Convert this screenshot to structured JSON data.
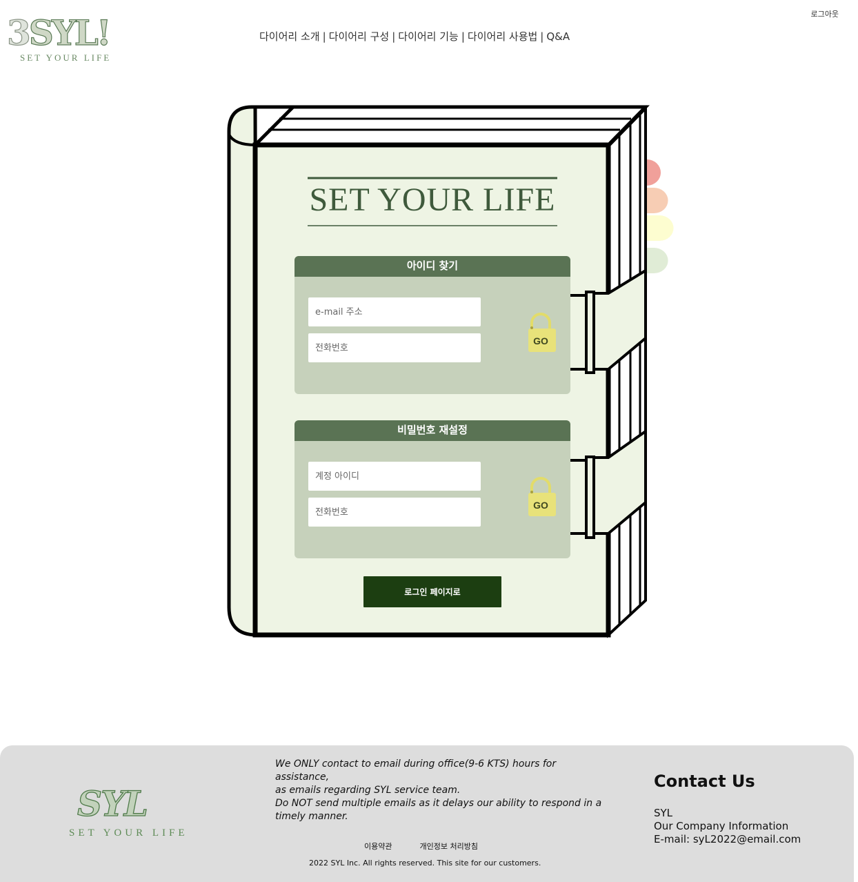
{
  "header": {
    "logo_main_digit": "3",
    "logo_main_text": "SYL!",
    "logo_sub": "SET YOUR LIFE",
    "nav": [
      "다이어리 소개",
      "다이어리 구성",
      "다이어리 기능",
      "다이어리 사용법",
      "Q&A"
    ],
    "nav_separator": "|",
    "logout": "로그아웃"
  },
  "book": {
    "title": "SET YOUR LIFE",
    "tab_colors": [
      "#f0a09a",
      "#f7cdb4",
      "#fdfdd0",
      "#e0ecd6"
    ],
    "cover_color": "#eef4e4",
    "find_id": {
      "heading": "아이디 찾기",
      "email_placeholder": "e-mail 주소",
      "phone_placeholder": "전화번호",
      "go_label": "GO"
    },
    "reset_password": {
      "heading": "비밀번호 재설정",
      "account_placeholder": "계정 아이디",
      "phone_placeholder": "전화번호",
      "go_label": "GO"
    },
    "to_login_label": "로그인 페이지로"
  },
  "footer": {
    "logo_main": "SYL",
    "logo_sub": "SET YOUR LIFE",
    "notice_lines": [
      "We ONLY contact to email during office(9-6 KTS) hours for assistance,",
      "as emails regarding SYL service team.",
      "Do NOT send multiple emails as it delays our ability to respond in a",
      "timely manner."
    ],
    "links": [
      "이용약관",
      "개인정보 처리방침"
    ],
    "copyright": "2022 SYL Inc. All rights reserved. This site for our customers.",
    "contact_title": "Contact Us",
    "contact_lines": [
      "SYL",
      "Our Company Information",
      "E-mail: syL2022@email.com"
    ]
  }
}
